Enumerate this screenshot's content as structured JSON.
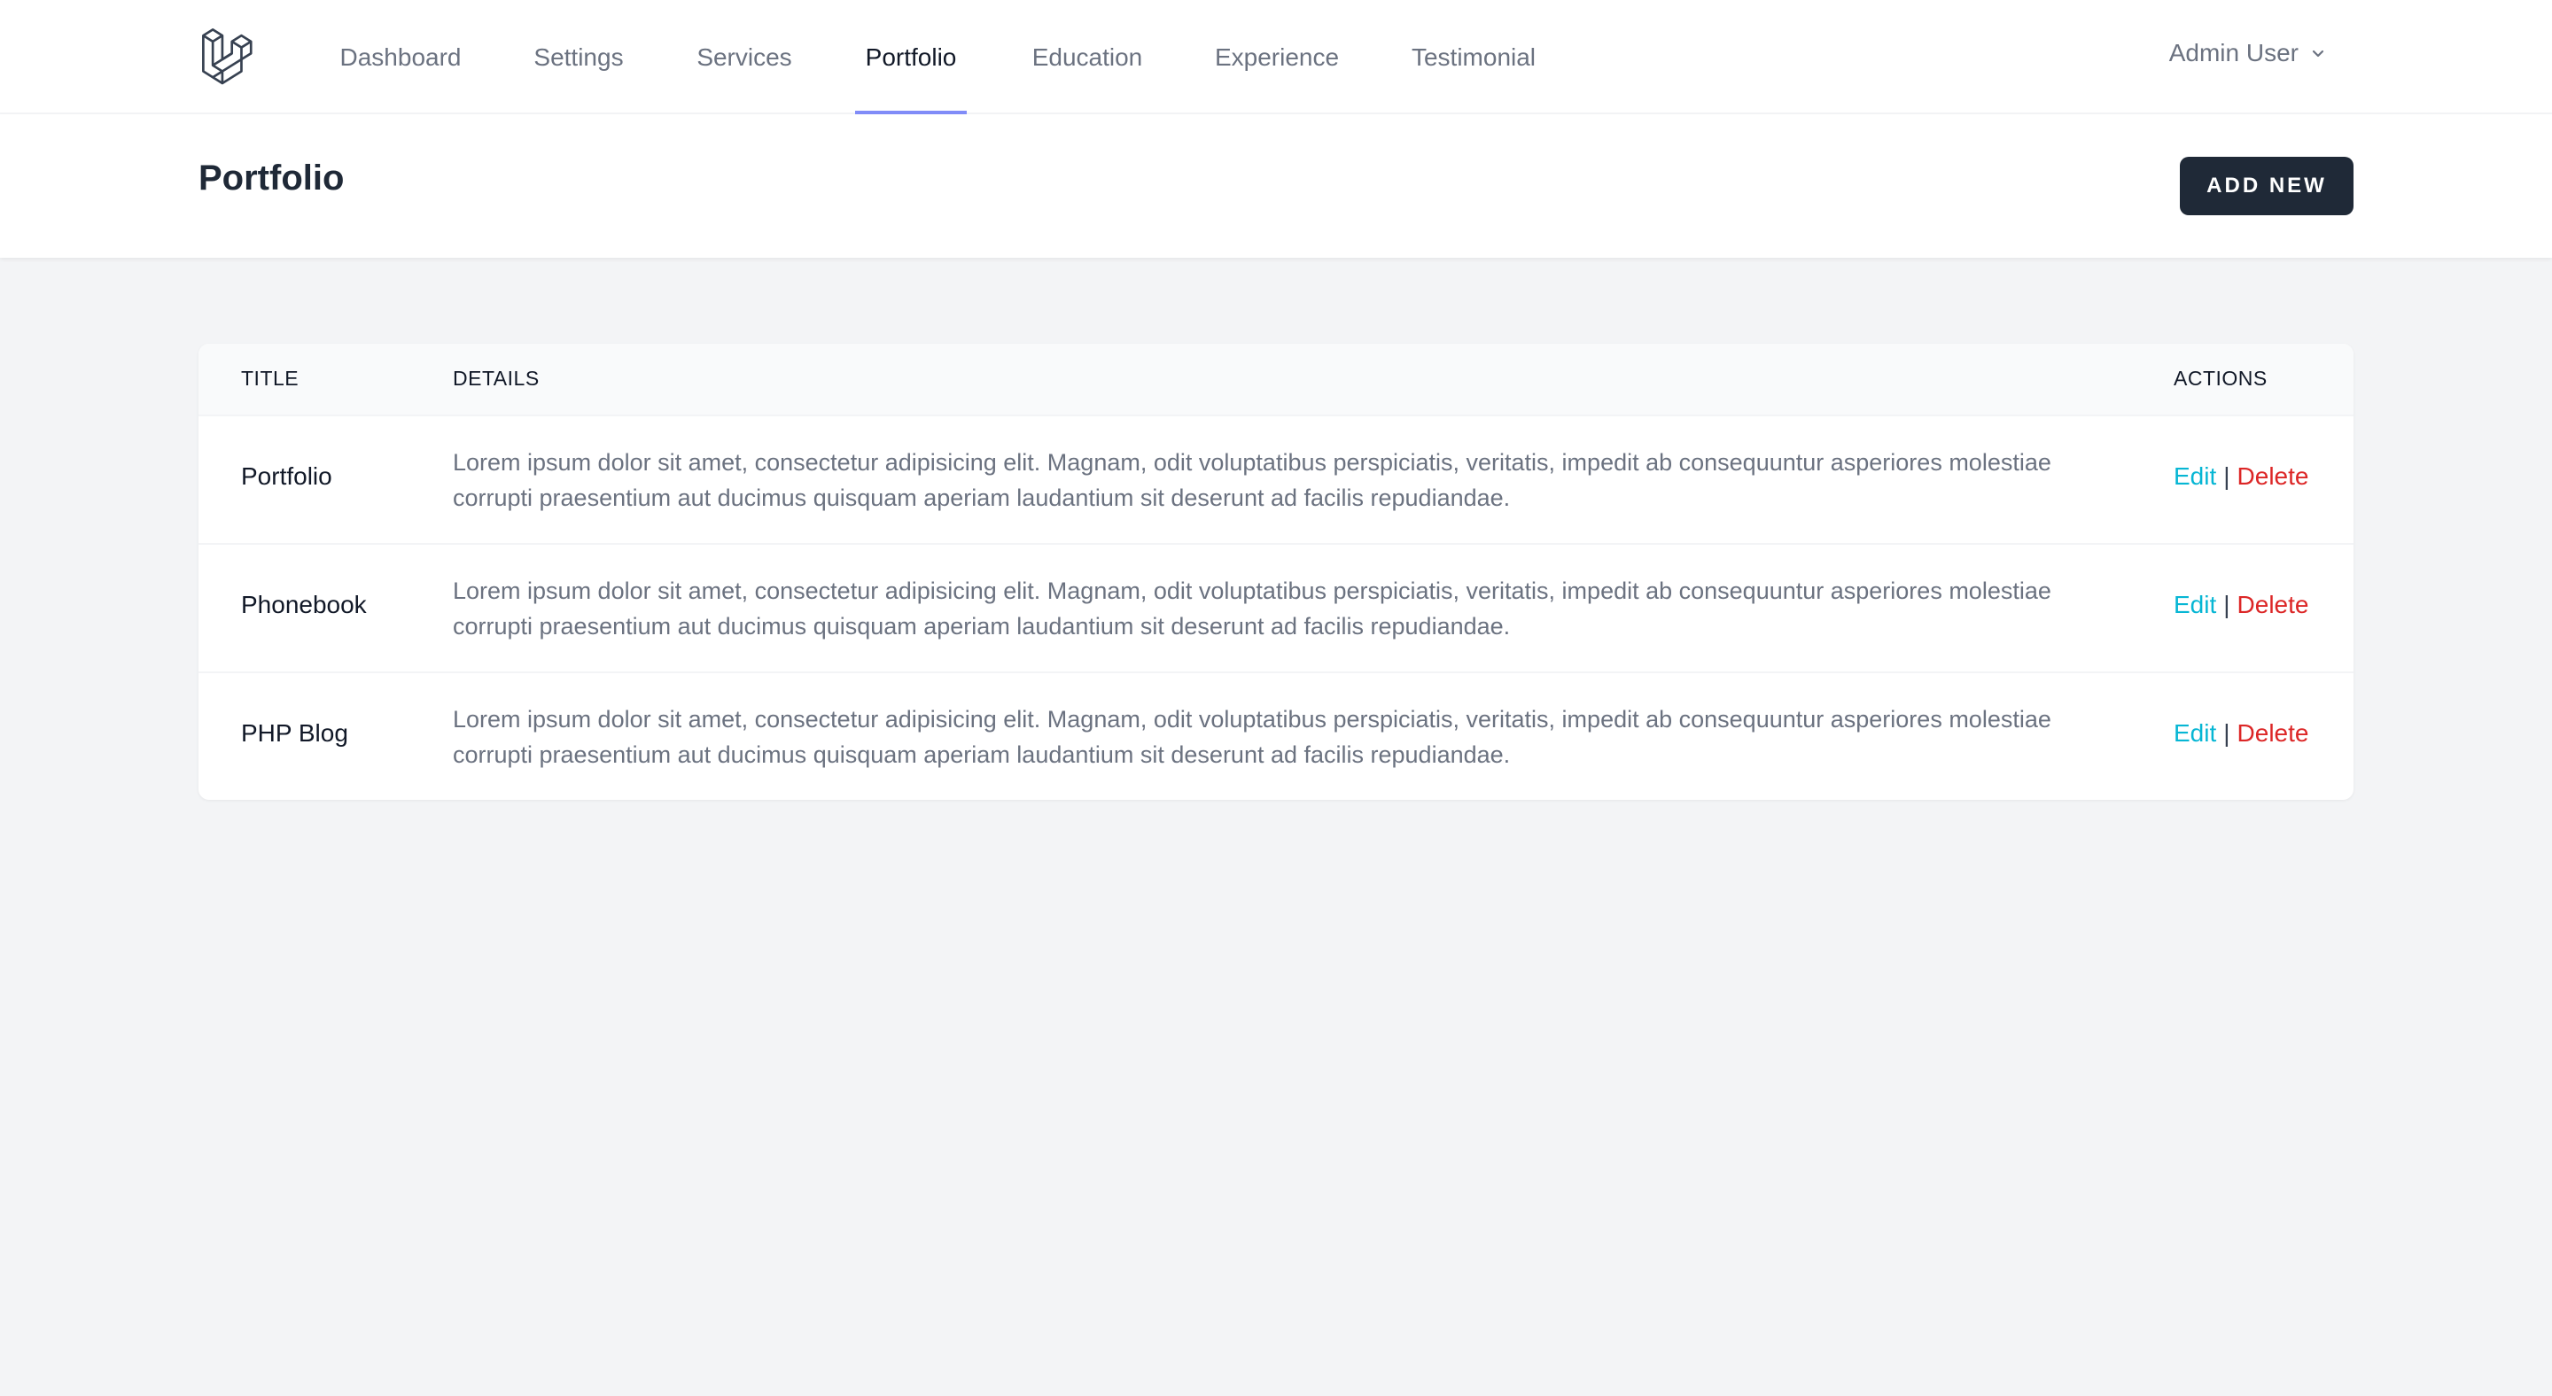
{
  "nav": {
    "items": [
      {
        "label": "Dashboard",
        "active": false
      },
      {
        "label": "Settings",
        "active": false
      },
      {
        "label": "Services",
        "active": false
      },
      {
        "label": "Portfolio",
        "active": true
      },
      {
        "label": "Education",
        "active": false
      },
      {
        "label": "Experience",
        "active": false
      },
      {
        "label": "Testimonial",
        "active": false
      }
    ],
    "user": {
      "name": "Admin User",
      "icon": "chevron-down-icon"
    },
    "logo_icon": "laravel-logo-icon",
    "accent_color": "#818cf8"
  },
  "header": {
    "title": "Portfolio",
    "add_button_label": "ADD NEW",
    "button_color": "#1f2937"
  },
  "table": {
    "columns": [
      "TITLE",
      "DETAILS",
      "ACTIONS"
    ],
    "rows": [
      {
        "title": "Portfolio",
        "details": "Lorem ipsum dolor sit amet, consectetur adipisicing elit. Magnam, odit voluptatibus perspiciatis, veritatis, impedit ab consequuntur asperiores molestiae corrupti praesentium aut ducimus quisquam aperiam laudantium sit deserunt ad facilis repudiandae.",
        "edit": "Edit",
        "separator": "|",
        "delete": "Delete"
      },
      {
        "title": "Phonebook",
        "details": "Lorem ipsum dolor sit amet, consectetur adipisicing elit. Magnam, odit voluptatibus perspiciatis, veritatis, impedit ab consequuntur asperiores molestiae corrupti praesentium aut ducimus quisquam aperiam laudantium sit deserunt ad facilis repudiandae.",
        "edit": "Edit",
        "separator": "|",
        "delete": "Delete"
      },
      {
        "title": "PHP Blog",
        "details": "Lorem ipsum dolor sit amet, consectetur adipisicing elit. Magnam, odit voluptatibus perspiciatis, veritatis, impedit ab consequuntur asperiores molestiae corrupti praesentium aut ducimus quisquam aperiam laudantium sit deserunt ad facilis repudiandae.",
        "edit": "Edit",
        "separator": "|",
        "delete": "Delete"
      }
    ],
    "edit_color": "#06b6d4",
    "delete_color": "#dc2626"
  }
}
